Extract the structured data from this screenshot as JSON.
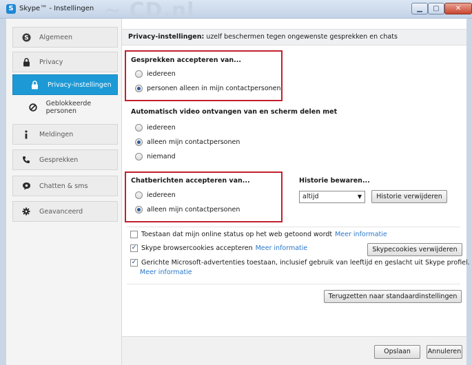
{
  "window": {
    "title": "Skype™ - Instellingen",
    "logo_letter": "S",
    "watermark": "~ CD.nl",
    "controls": {
      "minimize": "▁",
      "maximize": "▢",
      "close": "✕"
    }
  },
  "sidebar": {
    "items": [
      {
        "label": "Algemeen",
        "icon": "skype-icon"
      },
      {
        "label": "Privacy",
        "icon": "lock-icon"
      },
      {
        "label": "Privacy-instellingen",
        "icon": "lock-icon",
        "active": true
      },
      {
        "label": "Geblokkeerde personen",
        "icon": "block-icon"
      },
      {
        "label": "Meldingen",
        "icon": "info-icon"
      },
      {
        "label": "Gesprekken",
        "icon": "phone-icon"
      },
      {
        "label": "Chatten & sms",
        "icon": "chat-icon"
      },
      {
        "label": "Geavanceerd",
        "icon": "gear-icon"
      }
    ]
  },
  "header": {
    "bold": "Privacy-instellingen:",
    "text": " uzelf beschermen tegen ongewenste gesprekken en chats"
  },
  "calls": {
    "title": "Gesprekken accepteren van...",
    "options": [
      "iedereen",
      "personen alleen in mijn contactpersonen"
    ],
    "selected": 1
  },
  "video": {
    "title": "Automatisch video ontvangen van en scherm delen met",
    "options": [
      "iedereen",
      "alleen mijn contactpersonen",
      "niemand"
    ],
    "selected": 1
  },
  "chat": {
    "title": "Chatberichten accepteren van...",
    "options": [
      "iedereen",
      "alleen mijn contactpersonen"
    ],
    "selected": 1
  },
  "history": {
    "title": "Historie bewaren...",
    "value": "altijd",
    "clear_button": "Historie verwijderen"
  },
  "checks": {
    "online_status": {
      "label": "Toestaan dat mijn online status op het web getoond wordt",
      "link": "Meer informatie",
      "checked": false
    },
    "cookies": {
      "label": "Skype browsercookies accepteren",
      "link": "Meer informatie",
      "checked": true,
      "button": "Skypecookies verwijderen"
    },
    "ads": {
      "label": "Gerichte Microsoft-advertenties toestaan, inclusief gebruik van leeftijd en geslacht uit Skype profiel.",
      "link": "Meer informatie",
      "checked": true
    }
  },
  "reset_button": "Terugzetten naar standaardinstellingen",
  "footer": {
    "save": "Opslaan",
    "cancel": "Annuleren"
  },
  "colors": {
    "accent": "#1d9ad6",
    "highlight": "#c2202d",
    "link": "#2a77c9"
  }
}
